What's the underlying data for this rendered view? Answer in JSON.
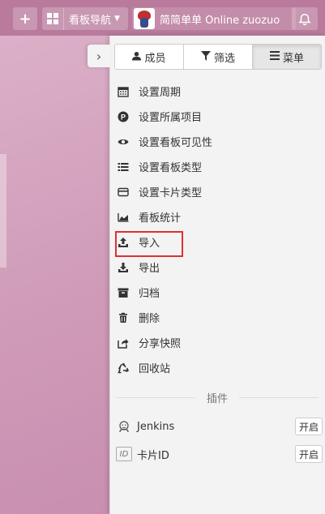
{
  "topbar": {
    "board_nav_label": "看板导航",
    "board_title": "简简单单 Online zuozuo"
  },
  "tabs": [
    {
      "label": "成员",
      "icon": "user-icon"
    },
    {
      "label": "筛选",
      "icon": "filter-icon"
    },
    {
      "label": "菜单",
      "icon": "bars-icon",
      "active": true
    }
  ],
  "menu": {
    "items": [
      {
        "label": "设置周期",
        "icon": "calendar-icon"
      },
      {
        "label": "设置所属项目",
        "icon": "project-icon"
      },
      {
        "label": "设置看板可见性",
        "icon": "eye-icon"
      },
      {
        "label": "设置看板类型",
        "icon": "list-icon"
      },
      {
        "label": "设置卡片类型",
        "icon": "card-icon"
      },
      {
        "label": "看板统计",
        "icon": "area-chart-icon"
      },
      {
        "label": "导入",
        "icon": "upload-icon"
      },
      {
        "label": "导出",
        "icon": "download-icon"
      },
      {
        "label": "归档",
        "icon": "archive-icon"
      },
      {
        "label": "删除",
        "icon": "trash-icon"
      },
      {
        "label": "分享快照",
        "icon": "share-icon"
      },
      {
        "label": "回收站",
        "icon": "recycle-icon"
      }
    ]
  },
  "plugins": {
    "heading": "插件",
    "items": [
      {
        "name": "Jenkins",
        "button": "开启",
        "icon": "jenkins-icon"
      },
      {
        "name": "卡片ID",
        "button": "开启",
        "icon": "id-icon",
        "icon_text": "ID"
      }
    ]
  },
  "colors": {
    "topbar": "#b97a9c",
    "background": "#d9a9c2",
    "highlight": "#e03030"
  }
}
